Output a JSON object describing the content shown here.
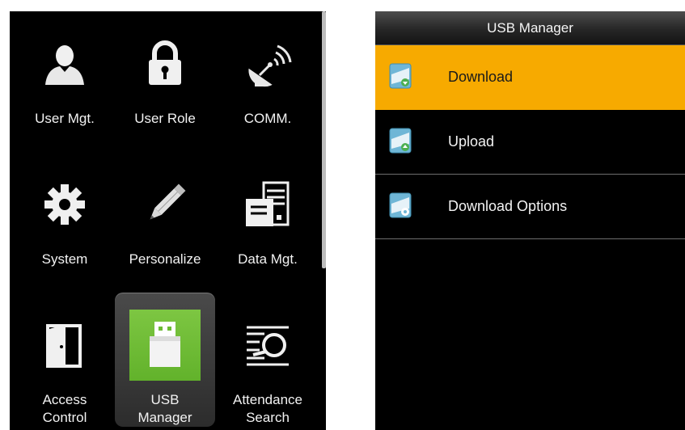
{
  "main_menu": {
    "tiles": [
      {
        "label": "User Mgt.",
        "icon": "user-icon"
      },
      {
        "label": "User Role",
        "icon": "lock-icon"
      },
      {
        "label": "COMM.",
        "icon": "satellite-dish-icon"
      },
      {
        "label": "System",
        "icon": "gear-icon"
      },
      {
        "label": "Personalize",
        "icon": "pencil-icon"
      },
      {
        "label": "Data Mgt.",
        "icon": "server-icon"
      },
      {
        "label_line1": "Access",
        "label_line2": "Control",
        "icon": "door-icon"
      },
      {
        "label_line1": "USB",
        "label_line2": "Manager",
        "icon": "usb-drive-icon",
        "selected": true
      },
      {
        "label_line1": "Attendance",
        "label_line2": "Search",
        "icon": "magnifier-search-icon"
      }
    ]
  },
  "usb_manager": {
    "title": "USB Manager",
    "items": [
      {
        "label": "Download",
        "icon": "usb-download-icon",
        "active": true
      },
      {
        "label": "Upload",
        "icon": "usb-upload-icon",
        "active": false
      },
      {
        "label": "Download Options",
        "icon": "usb-options-icon",
        "active": false
      }
    ]
  },
  "colors": {
    "panel_background": "#000000",
    "highlight": "#f7aa00",
    "usb_tile_green": "#6cbb34",
    "text": "#f2f2f2"
  }
}
